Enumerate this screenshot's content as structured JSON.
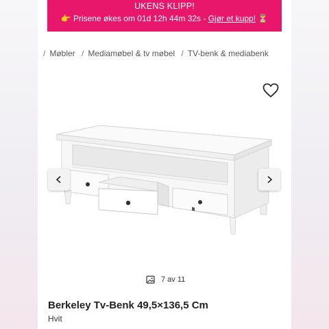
{
  "promo": {
    "title": "UKENS KLIPP!",
    "emoji": "👉",
    "text": "Prisene økes om 01d 12h 44m 32s - ",
    "link": "Gjør et kupp!",
    "hourglass": "⏳",
    "background": "#e8176b"
  },
  "breadcrumb": {
    "separator": "/",
    "items": [
      "Møbler",
      "Mediamøbel & tv møbel",
      "TV-benk & mediabenk"
    ]
  },
  "gallery": {
    "counter": "7 av 11",
    "current": 7,
    "total": 11,
    "icons": {
      "favorite": "heart-icon",
      "prev": "chevron-left-icon",
      "next": "chevron-right-icon",
      "counter": "image-icon"
    }
  },
  "product": {
    "title": "Berkeley Tv-Benk 49,5×136,5 Cm",
    "color": "Hvit"
  }
}
